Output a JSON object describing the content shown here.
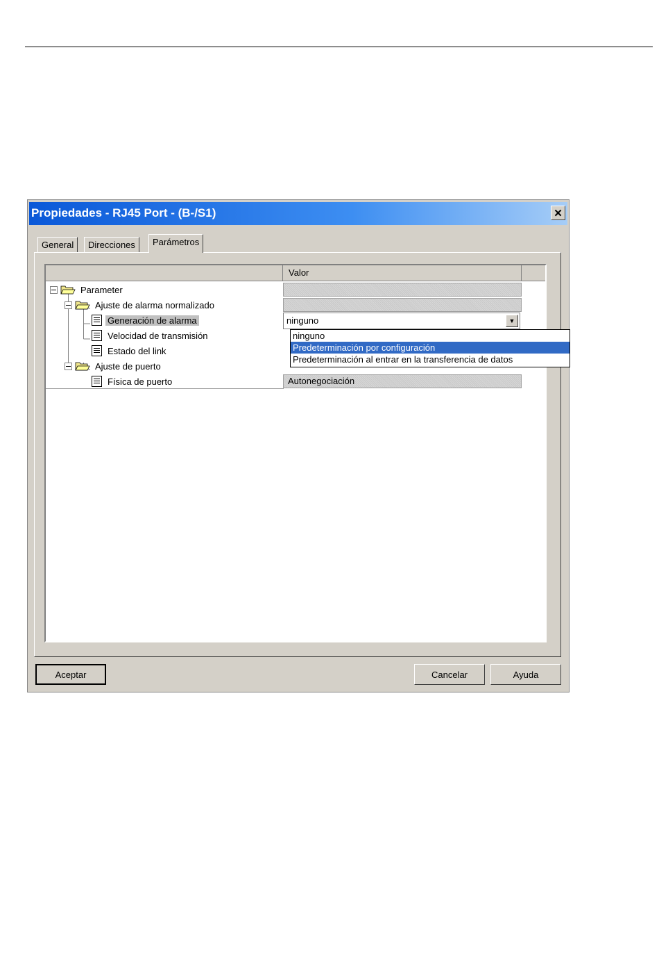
{
  "window": {
    "title": "Propiedades - RJ45 Port - (B-/S1)",
    "close_glyph": "✕"
  },
  "tabs": [
    {
      "label": "General"
    },
    {
      "label": "Direcciones"
    },
    {
      "label": "Parámetros"
    }
  ],
  "grid": {
    "header_value": "Valor",
    "rows": [
      {
        "label": "Parameter",
        "icon": "folder-open-icon"
      },
      {
        "label": "Ajuste de alarma normalizado",
        "icon": "folder-open-icon"
      },
      {
        "label": "Generación de alarma",
        "icon": "parameter-doc-icon"
      },
      {
        "label": "Velocidad de transmisión",
        "icon": "parameter-doc-icon"
      },
      {
        "label": "Estado del link",
        "icon": "parameter-doc-icon"
      },
      {
        "label": "Ajuste de puerto",
        "icon": "folder-open-icon"
      },
      {
        "label": "Física de puerto",
        "icon": "parameter-doc-icon"
      }
    ],
    "combo_value": "ninguno",
    "port_physics_value": "Autonegociación"
  },
  "dropdown": {
    "options": [
      "ninguno",
      "Predeterminación por configuración",
      "Predeterminación al entrar en la transferencia de datos"
    ],
    "highlighted_index": 1
  },
  "buttons": {
    "accept": "Aceptar",
    "cancel": "Cancelar",
    "help": "Ayuda"
  },
  "colors": {
    "titlebar_start": "#0a58d8",
    "highlight": "#316ac5",
    "dialog_face": "#d4d0c8"
  }
}
